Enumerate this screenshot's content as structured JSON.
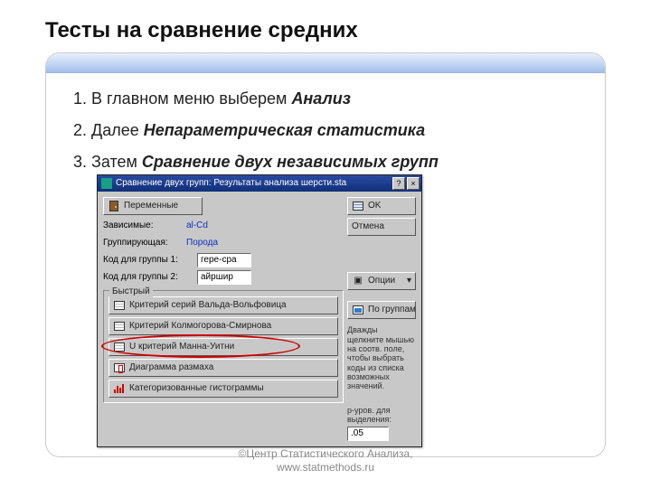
{
  "slide": {
    "title": "Тесты на сравнение средних",
    "footer_line1": "©Центр Статистического Анализа,",
    "footer_line2": "www.statmethods.ru"
  },
  "steps": [
    {
      "prefix": "В главном меню выберем ",
      "bold": "Анализ"
    },
    {
      "prefix": "Далее ",
      "bold": "Непараметрическая статистика"
    },
    {
      "prefix": "Затем ",
      "bold": "Сравнение двух независимых групп"
    }
  ],
  "dialog": {
    "title": "Сравнение двух групп: Результаты анализа шерсти.sta",
    "btn_variables": "Переменные",
    "dependent_label": "Зависимые:",
    "dependent_value": "al-Cd",
    "grouping_label": "Группирующая:",
    "grouping_value": "Порода",
    "code_g1_label": "Код для группы 1:",
    "code_g1_value": "гере-сра",
    "code_g2_label": "Код для группы 2:",
    "code_g2_value": "айршир",
    "quick_legend": "Быстрый",
    "tests": [
      "Критерий серий Вальда-Вольфовица",
      "Критерий Колмогорова-Смирнова",
      "U критерий Манна-Уитни",
      "Диаграмма размаха",
      "Категоризованные гистограммы"
    ],
    "ok": "OK",
    "cancel": "Отмена",
    "options": "Опции",
    "by_groups": "По группам",
    "hint1": "Дважды щелкните мышью на соотв. поле, чтобы выбрать коды из списка возможных значений.",
    "hint2_label": "p-уров. для выделения:",
    "hint2_value": ".05"
  }
}
